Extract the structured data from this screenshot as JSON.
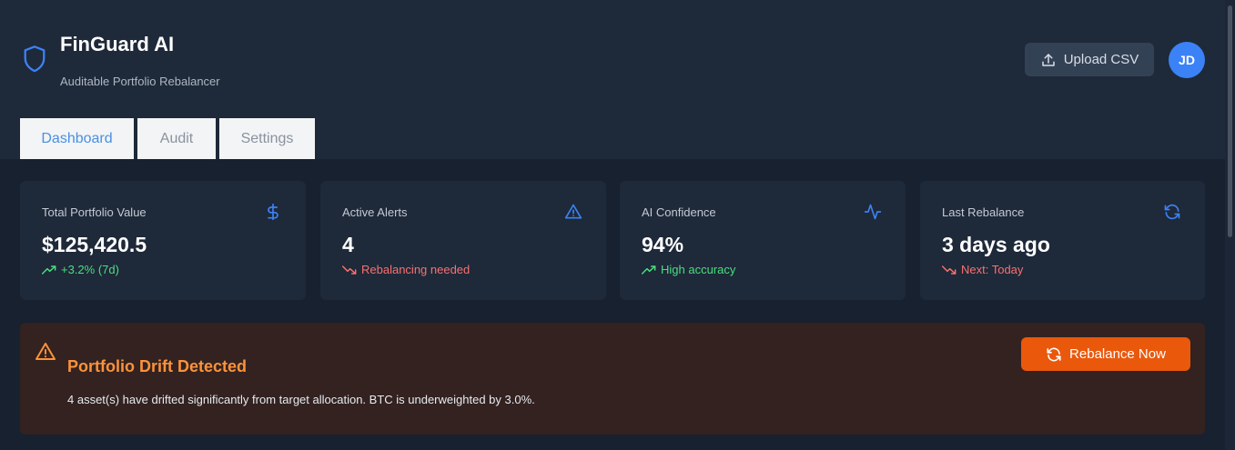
{
  "header": {
    "title": "FinGuard AI",
    "subtitle": "Auditable Portfolio Rebalancer",
    "upload_label": "Upload CSV",
    "avatar_initials": "JD"
  },
  "tabs": [
    {
      "label": "Dashboard",
      "active": true
    },
    {
      "label": "Audit",
      "active": false
    },
    {
      "label": "Settings",
      "active": false
    }
  ],
  "cards": [
    {
      "label": "Total Portfolio Value",
      "value": "$125,420.5",
      "trend": "+3.2% (7d)",
      "trend_dir": "up",
      "icon": "dollar-icon"
    },
    {
      "label": "Active Alerts",
      "value": "4",
      "trend": "Rebalancing needed",
      "trend_dir": "down",
      "icon": "warning-icon"
    },
    {
      "label": "AI Confidence",
      "value": "94%",
      "trend": "High accuracy",
      "trend_dir": "up",
      "icon": "activity-icon"
    },
    {
      "label": "Last Rebalance",
      "value": "3 days ago",
      "trend": "Next: Today",
      "trend_dir": "down",
      "icon": "refresh-icon"
    }
  ],
  "alert": {
    "title": "Portfolio Drift Detected",
    "description": "4 asset(s) have drifted significantly from target allocation. BTC is underweighted by 3.0%.",
    "action_label": "Rebalance Now"
  },
  "colors": {
    "accent": "#3b82f6",
    "success": "#4ade80",
    "danger": "#f87171",
    "warning": "#fb923c",
    "action": "#ea580c"
  }
}
